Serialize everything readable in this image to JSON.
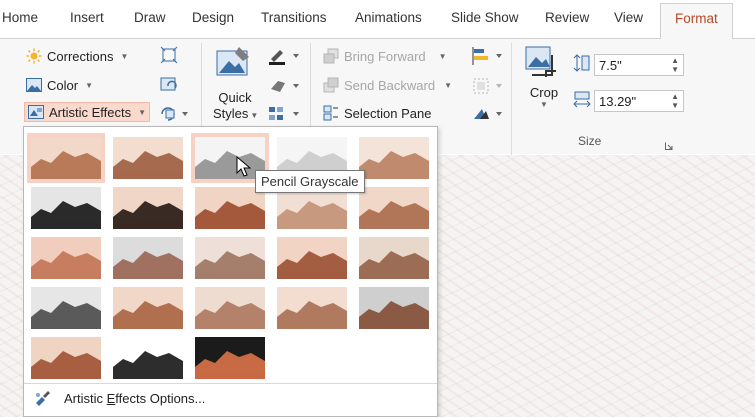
{
  "tabs": [
    "Home",
    "Insert",
    "Draw",
    "Design",
    "Transitions",
    "Animations",
    "Slide Show",
    "Review",
    "View",
    "Format"
  ],
  "active_tab": "Format",
  "adjust": {
    "corrections": "Corrections",
    "color": "Color",
    "artistic_effects": "Artistic Effects"
  },
  "styles": {
    "quick_styles_line1": "Quick",
    "quick_styles_line2": "Styles"
  },
  "arrange": {
    "bring_forward": "Bring Forward",
    "send_backward": "Send Backward",
    "selection_pane": "Selection Pane"
  },
  "size": {
    "crop": "Crop",
    "height": "7.5\"",
    "width": "13.29\"",
    "group_label": "Size"
  },
  "gallery": {
    "tooltip": "Pencil Grayscale",
    "options_label_prefix": "Artistic ",
    "options_label_accel": "E",
    "options_label_suffix": "ffects Options...",
    "effects_count": 23,
    "selected_index": 0,
    "hovered_index": 2
  },
  "colors": {
    "accent": "#b7472a",
    "highlight": "#f7d2c4"
  }
}
